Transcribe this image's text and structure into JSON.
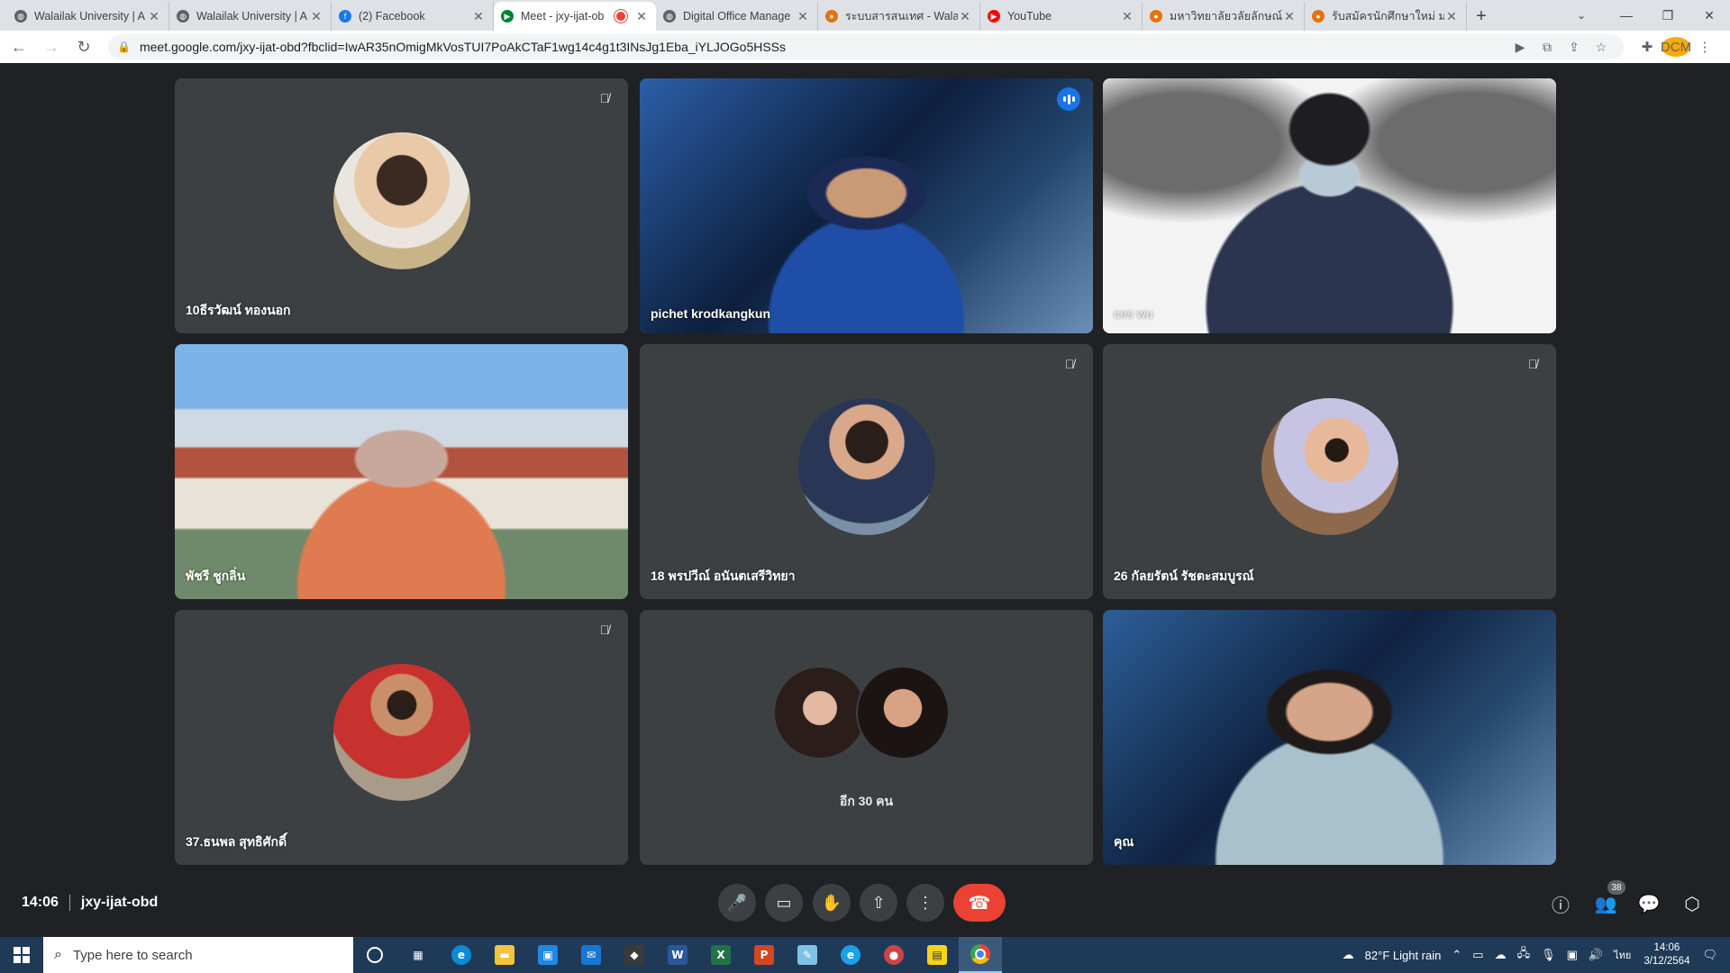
{
  "browser": {
    "tabs": [
      {
        "title": "Walailak University | A",
        "fav": "globe-icon",
        "color": "#5f6368"
      },
      {
        "title": "Walailak University | A",
        "fav": "globe-icon",
        "color": "#5f6368"
      },
      {
        "title": "(2) Facebook",
        "fav": "facebook-icon",
        "color": "#1877f2"
      },
      {
        "title": "Meet - jxy-ijat-ob",
        "fav": "meet-icon",
        "color": "#00832d",
        "active": true,
        "recording": true
      },
      {
        "title": "Digital Office Manage",
        "fav": "globe-icon",
        "color": "#5f6368"
      },
      {
        "title": "ระบบสารสนเทศ - Walail",
        "fav": "flame-icon",
        "color": "#e8710a"
      },
      {
        "title": "YouTube",
        "fav": "youtube-icon",
        "color": "#ff0000"
      },
      {
        "title": "มหาวิทยาลัยวลัยลักษณ์",
        "fav": "flame-icon",
        "color": "#e8710a"
      },
      {
        "title": "รับสมัครนักศึกษาใหม่ มห",
        "fav": "flame-icon",
        "color": "#e8710a"
      }
    ],
    "url": "meet.google.com/jxy-ijat-obd?fbclid=IwAR35nOmigMkVosTUI7PoAkCTaF1wg14c4g1t3INsJg1Eba_iYLJOGo5HSSs",
    "profile_initials": "DCM"
  },
  "tiles": [
    {
      "name": "10ธีรวัฒน์ ทองนอก",
      "muted": true
    },
    {
      "name": "pichet krodkangkun",
      "speaking": true
    },
    {
      "name": "ces wu"
    },
    {
      "name": "พัชรี ชูกลิ่น"
    },
    {
      "name": "18 พรปวีณ์ อนันตเสรีวิทยา",
      "muted": true
    },
    {
      "name": "26 กัลยรัตน์ รัชตะสมบูรณ์",
      "muted": true
    },
    {
      "name": "37.ธนพล สุทธิศักดิ์",
      "muted": true
    },
    {
      "name": "อีก 30 คน"
    },
    {
      "name": "คุณ"
    }
  ],
  "meeting": {
    "time": "14:06",
    "code": "jxy-ijat-obd",
    "participant_count": "38"
  },
  "taskbar": {
    "search_placeholder": "Type here to search",
    "weather": "82°F  Light rain",
    "lang": "ไทย",
    "clock_time": "14:06",
    "clock_date": "3/12/2564"
  },
  "colors": {
    "meet_bg": "#202124",
    "tile_bg": "#3c4043",
    "speaking_outline": "#8ab4f8",
    "end_call": "#ea4335"
  }
}
